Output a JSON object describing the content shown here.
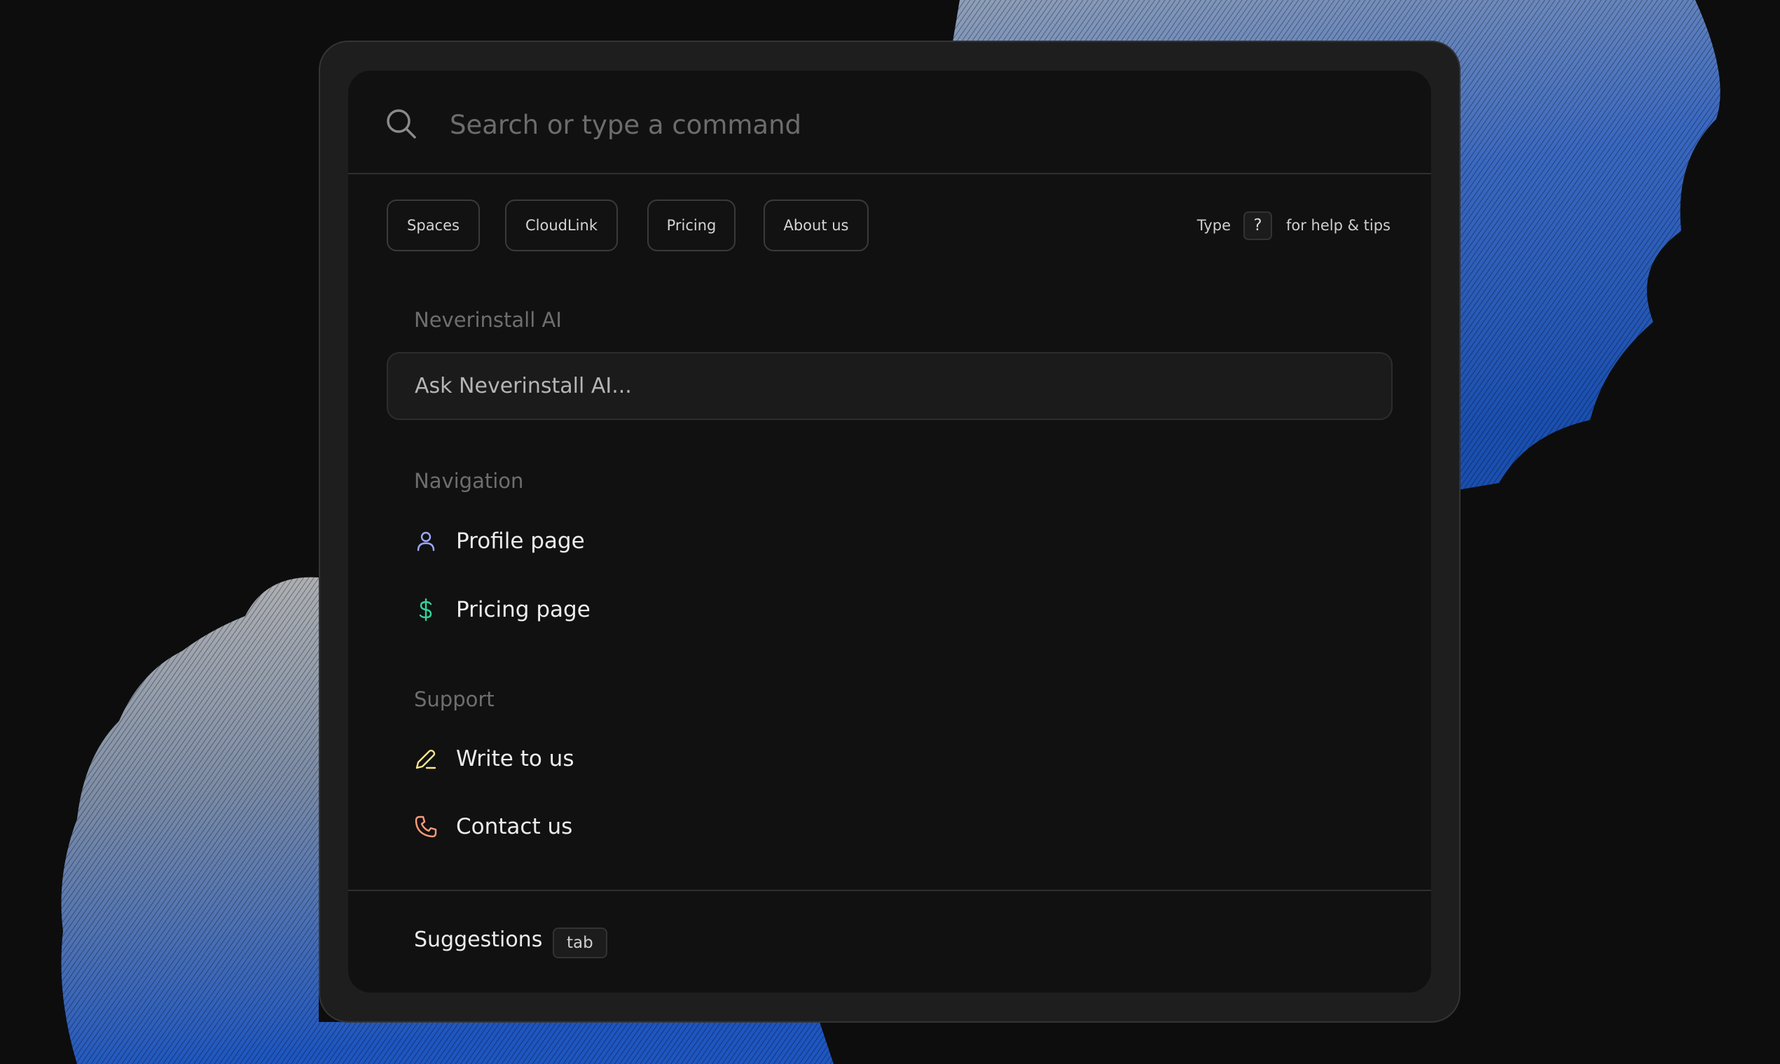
{
  "search": {
    "placeholder": "Search or type a command"
  },
  "chips": [
    {
      "label": "Spaces"
    },
    {
      "label": "CloudLink"
    },
    {
      "label": "Pricing"
    },
    {
      "label": "About us"
    }
  ],
  "hint": {
    "prefix": "Type",
    "key": "?",
    "suffix": "for help & tips"
  },
  "ai": {
    "title": "Neverinstall AI",
    "prompt": "Ask Neverinstall AI..."
  },
  "navigation": {
    "title": "Navigation",
    "items": [
      {
        "label": "Profile page",
        "icon": "user-icon",
        "color": "#9fa8ff"
      },
      {
        "label": "Pricing page",
        "icon": "dollar-icon",
        "color": "#34d399"
      }
    ]
  },
  "support": {
    "title": "Support",
    "items": [
      {
        "label": "Write to us",
        "icon": "pencil-icon",
        "color": "#fde68a"
      },
      {
        "label": "Contact us",
        "icon": "phone-icon",
        "color": "#fb9a7a"
      }
    ]
  },
  "footer": {
    "suggestions_label": "Suggestions",
    "key": "tab"
  },
  "colors": {
    "background": "#0d0d0d",
    "palette": "#111111",
    "accent_blue": "#2f64c8"
  }
}
